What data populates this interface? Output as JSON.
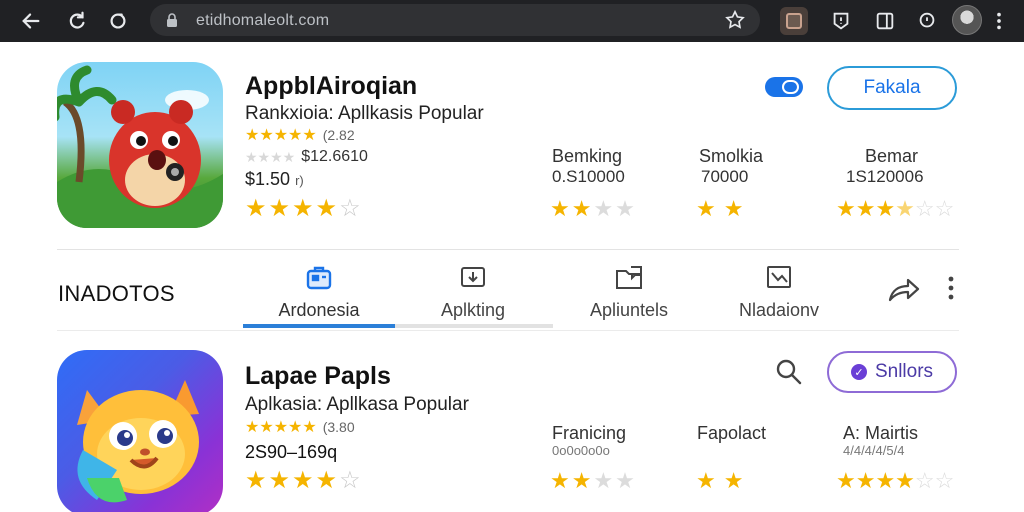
{
  "browser": {
    "url": "etidhomaleolt.com",
    "colors": {
      "bar": "#202124",
      "omnibox": "#303134"
    }
  },
  "app1": {
    "title": "AppblAiroqian",
    "subtitle": "Rankxioia: Apllkasis Popular",
    "rating_count": "(2.82",
    "downloads": "$12.6610",
    "price": "$1.50",
    "price_suffix": "r)",
    "stars": 4,
    "stats": [
      {
        "label": "Bemking",
        "value": "0.S10000",
        "stars": 2
      },
      {
        "label": "Smolkia",
        "value": "70000",
        "stars": 2
      },
      {
        "label": "Bemar",
        "value": "1S120006",
        "stars": 3.5
      }
    ],
    "follow_label": "Fakala"
  },
  "tabs_section": {
    "title": "INADOTOS",
    "tabs": [
      {
        "label": "Ardonesia",
        "icon": "briefcase-icon",
        "active": true
      },
      {
        "label": "Aplkting",
        "icon": "download-board-icon",
        "active": false
      },
      {
        "label": "Apliuntels",
        "icon": "folder-chat-icon",
        "active": false
      },
      {
        "label": "Nladaionv",
        "icon": "chart-icon",
        "active": false
      }
    ]
  },
  "app2": {
    "title": "Lapae Papls",
    "subtitle": "Aplkasia: Apllkasa Popular",
    "rating_count": "(3.80",
    "price": "2S90–169q",
    "stars": 4,
    "stats": [
      {
        "label": "Franicing",
        "value": "0o0o0o0o",
        "stars": 2
      },
      {
        "label": "Fapolact",
        "value": "",
        "stars": 2
      },
      {
        "label": "A: Mairtis",
        "value": "4/4/4/4/5/4",
        "stars": 4
      }
    ],
    "action_label": "Snllors"
  },
  "accent_colors": {
    "blue": "#1a73e8",
    "star": "#f5b400",
    "purple": "#6a3fd6"
  }
}
